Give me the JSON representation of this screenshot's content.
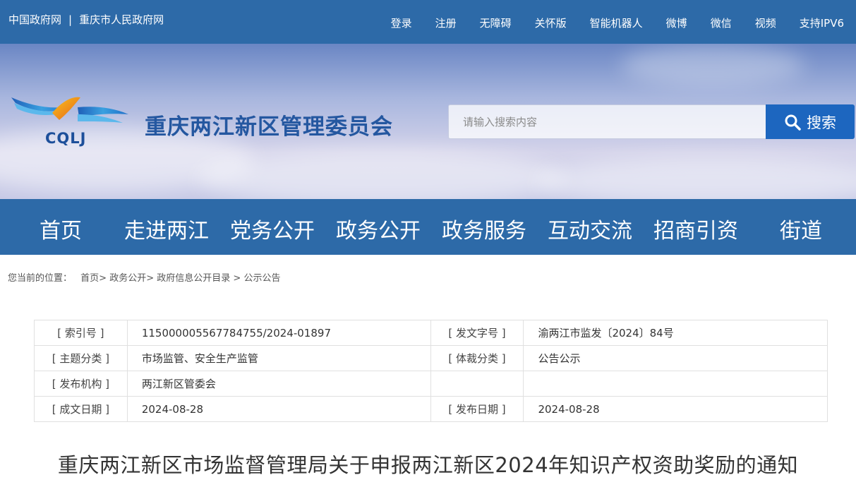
{
  "topbar": {
    "links_left": [
      "中国政府网",
      "重庆市人民政府网"
    ],
    "separator": "|",
    "links_right": [
      "登录",
      "注册",
      "无障碍",
      "关怀版",
      "智能机器人",
      "微博",
      "微信",
      "视频",
      "支持IPV6"
    ]
  },
  "header": {
    "logo_text": "CQLJ",
    "site_title": "重庆两江新区管理委员会",
    "search_placeholder": "请输入搜索内容",
    "search_button": "搜索"
  },
  "nav": {
    "items": [
      "首页",
      "走进两江",
      "党务公开",
      "政务公开",
      "政务服务",
      "互动交流",
      "招商引资",
      "街道"
    ]
  },
  "breadcrumb": {
    "prefix": "您当前的位置：",
    "items": [
      "首页",
      "政务公开",
      "政府信息公开目录",
      "公示公告"
    ]
  },
  "info_table": {
    "index_label": "[ 索引号 ]",
    "index_value": "115000005567784755/2024-01897",
    "docno_label": "[ 发文字号 ]",
    "docno_value": "渝两江市监发〔2024〕84号",
    "topic_label": "[ 主题分类 ]",
    "topic_value": "市场监管、安全生产监管",
    "genre_label": "[ 体裁分类 ]",
    "genre_value": "公告公示",
    "issuer_label": "[ 发布机构 ]",
    "issuer_value": "两江新区管委会",
    "created_label": "[ 成文日期 ]",
    "created_value": "2024-08-28",
    "published_label": "[ 发布日期 ]",
    "published_value": "2024-08-28"
  },
  "document": {
    "title": "重庆两江新区市场监督管理局关于申报两江新区2024年知识产权资助奖励的通知"
  },
  "colors": {
    "primary_blue": "#2d6aa8",
    "search_blue": "#1d66bf",
    "title_blue": "#2457a0"
  }
}
